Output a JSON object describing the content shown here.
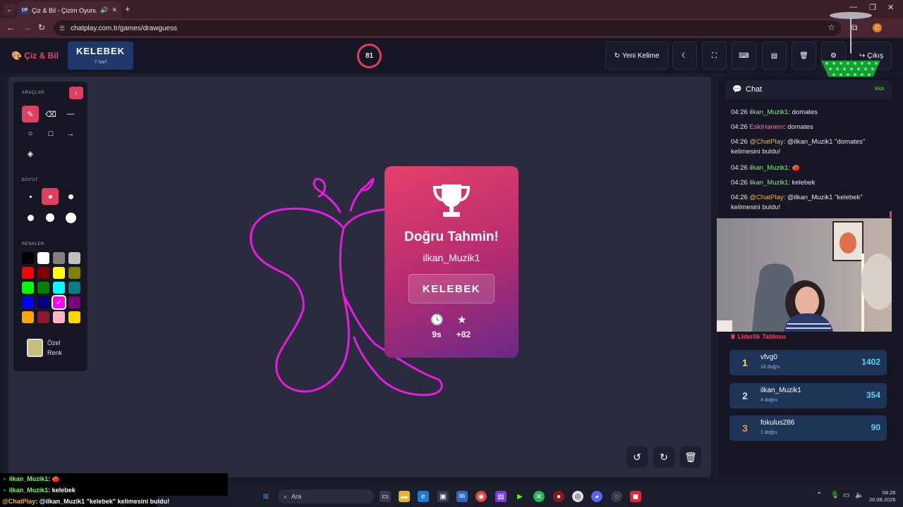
{
  "browser": {
    "tab_title": "Çiz & Bil - Çizim Oyunu",
    "tab_favicon": "CP",
    "url": "chatplay.com.tr/games/drawguess"
  },
  "header": {
    "logo": "Çiz & Bil",
    "word": "KELEBEK",
    "word_hint": "7 harf",
    "timer": "81",
    "new_word_label": "Yeni Kelime",
    "exit_label": "Çıkış"
  },
  "tools": {
    "tools_title": "ARAÇLAR",
    "size_title": "BOYUT",
    "colors_title": "RENKLER",
    "custom_label_1": "Özel",
    "custom_label_2": "Renk",
    "colors": [
      "#000000",
      "#ffffff",
      "#808080",
      "#c0c0c0",
      "#ff0000",
      "#800000",
      "#ffff00",
      "#808000",
      "#00ff00",
      "#008000",
      "#00ffff",
      "#008080",
      "#0000ff",
      "#000080",
      "#ff00ff",
      "#800080",
      "#ffa500",
      "#8b1a2a",
      "#ffb6c1",
      "#ffd700"
    ],
    "selected_color": "#ff00ff",
    "custom_color": "#c8bb80"
  },
  "modal": {
    "title": "Doğru Tahmin!",
    "user": "ilkan_Muzik1",
    "word": "KELEBEK",
    "time": "9s",
    "points": "+82"
  },
  "chat": {
    "title": "Chat",
    "platform": "Kick",
    "messages": [
      {
        "time": "04:26",
        "user": "ilkan_Muzik1",
        "text": ": domates",
        "color": "green"
      },
      {
        "time": "04:26",
        "user": "EskiHanem",
        "text": ": domates",
        "color": "pink"
      },
      {
        "time": "04:26",
        "user": "@ChatPlay",
        "text": ": @ilkan_Muzik1 \"domates\" kelimesini buldu!",
        "color": "orange"
      },
      {
        "time": "04:26",
        "user": "ilkan_Muzik1",
        "text": ": 🍅",
        "color": "green"
      },
      {
        "time": "04:26",
        "user": "ilkan_Muzik1",
        "text": ": kelebek",
        "color": "green"
      },
      {
        "time": "04:26",
        "user": "@ChatPlay",
        "text": ": @ilkan_Muzik1 \"kelebek\" kelimesini buldu!",
        "color": "orange"
      }
    ]
  },
  "leaderboard": {
    "title": "Liderlik Tablosu",
    "rows": [
      {
        "rank": "1",
        "name": "vfvg0",
        "sub": "16 doğru",
        "score": "1402",
        "rank_color": "#ffd84a"
      },
      {
        "rank": "2",
        "name": "ilkan_Muzik1",
        "sub": "4 doğru",
        "score": "354",
        "rank_color": "#d8dce6"
      },
      {
        "rank": "3",
        "name": "fokulus286",
        "sub": "1 doğru",
        "score": "90",
        "rank_color": "#e8924a"
      }
    ]
  },
  "overlay": {
    "lines": [
      {
        "user": "ilkan_Muzik1",
        "text": " : 🍅"
      },
      {
        "user": "ilkan_Muzik1",
        "text": " : kelebek"
      },
      {
        "user": "@ChatPlay",
        "text": " : @ilkan_Muzik1 \"kelebek\" kelimesini buldu!"
      }
    ]
  },
  "taskbar": {
    "search_placeholder": "Ara",
    "time": "04:26",
    "date": "20.08.2026"
  }
}
